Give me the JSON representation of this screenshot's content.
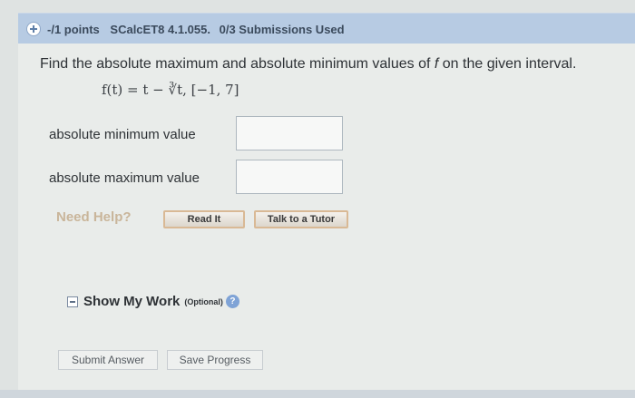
{
  "header": {
    "points": "-/1 points",
    "assignment_code": "SCalcET8 4.1.055.",
    "submissions": "0/3 Submissions Used",
    "expand_icon": "plus-circle-icon"
  },
  "question": {
    "text_before": "Find the absolute maximum and absolute minimum values of ",
    "function_symbol": "f",
    "text_after": " on the given interval.",
    "formula": "f(t) = t − ∛t,   [−1, 7]"
  },
  "answers": {
    "min_label": "absolute minimum value",
    "min_value": "",
    "max_label": "absolute maximum value",
    "max_value": ""
  },
  "help": {
    "need_help": "Need Help?",
    "read_it": "Read It",
    "talk_to_tutor": "Talk to a Tutor"
  },
  "show_work": {
    "label": "Show My Work",
    "optional": "(Optional)",
    "help_icon_glyph": "?"
  },
  "actions": {
    "submit": "Submit Answer",
    "save": "Save Progress"
  }
}
